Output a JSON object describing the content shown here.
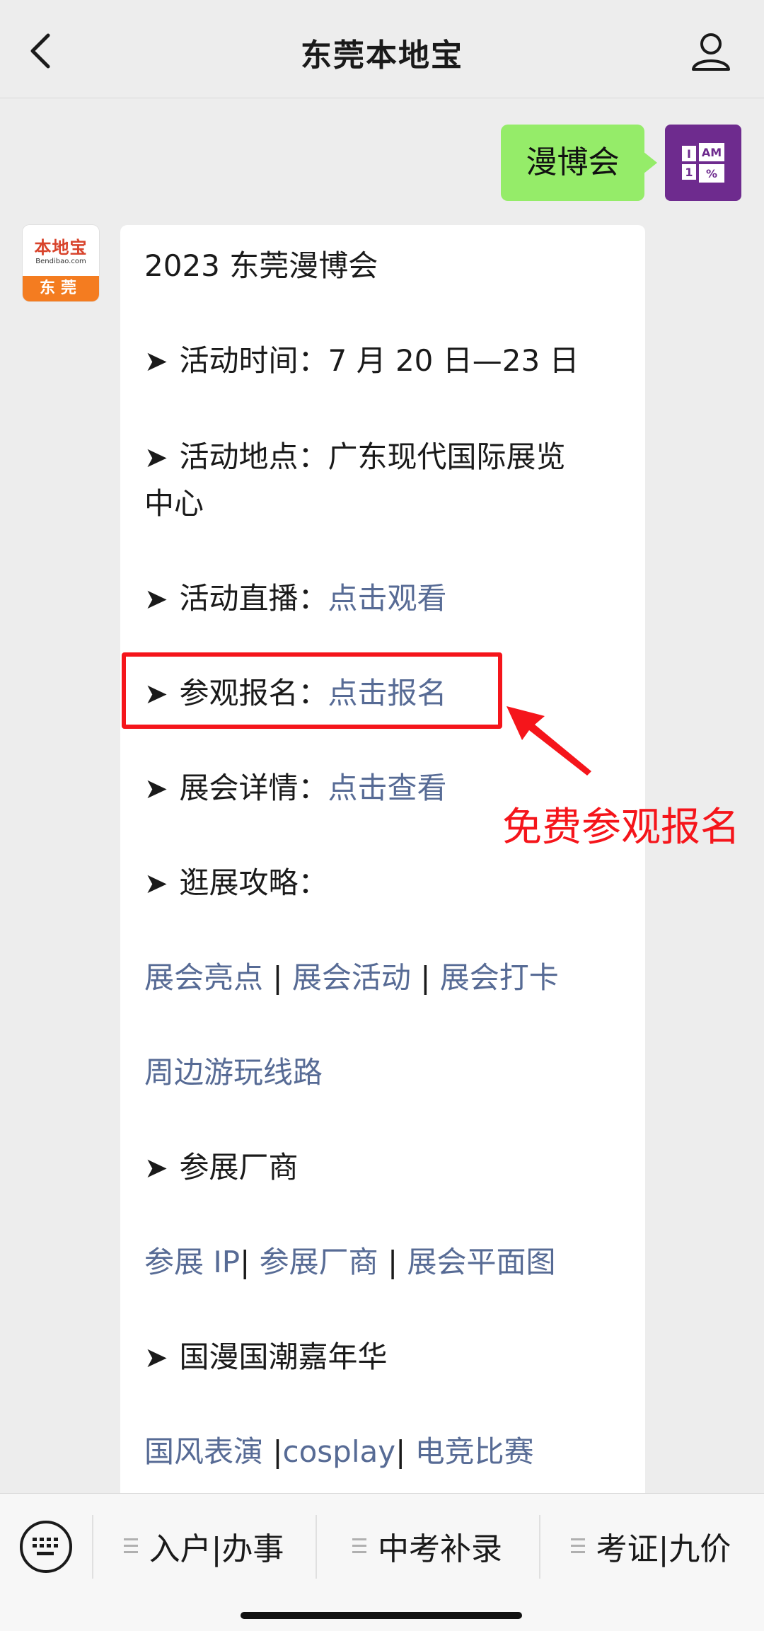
{
  "header": {
    "title": "东莞本地宝",
    "back_icon": "chevron-left-icon",
    "profile_icon": "user-icon"
  },
  "outgoing_message": {
    "text": "漫博会",
    "avatar_tiles": [
      "I",
      "AM",
      "1",
      "%"
    ]
  },
  "incoming_avatar": {
    "brand": "本地宝",
    "url": "Bendibao.com",
    "city": "东莞"
  },
  "article": {
    "title": "2023 东莞漫博会",
    "time_label": "活动时间：",
    "time_value": "7 月 20 日—23 日",
    "place_label": "活动地点：",
    "place_value": "广东现代国际展览",
    "place_value_cont": "中心",
    "live_label": "活动直播：",
    "live_link": "点击观看",
    "signup_label": "参观报名：",
    "signup_link": "点击报名",
    "detail_label": "展会详情：",
    "detail_link": "点击查看",
    "guide_label": "逛展攻略：",
    "guide_links": [
      "展会亮点",
      "展会活动",
      "展会打卡"
    ],
    "guide_link_4": "周边游玩线路",
    "exhibitors_label": "参展厂商",
    "exhibitor_links": [
      "参展 IP",
      "参展厂商",
      "展会平面图"
    ],
    "carnival_label": "国漫国潮嘉年华",
    "carnival_links": [
      "国风表演 ",
      "cosplay",
      " 电竞比赛"
    ],
    "arrow_glyph": "➤",
    "separator": "|"
  },
  "annotation": {
    "text": "免费参观报名",
    "color": "#f5151b"
  },
  "bottom_bar": {
    "keyboard_icon": "keyboard-icon",
    "menus": [
      "入户|办事",
      "中考补录",
      "考证|九价"
    ]
  },
  "colors": {
    "link": "#576b95",
    "bubble": "#95ec69",
    "background": "#ededed"
  }
}
